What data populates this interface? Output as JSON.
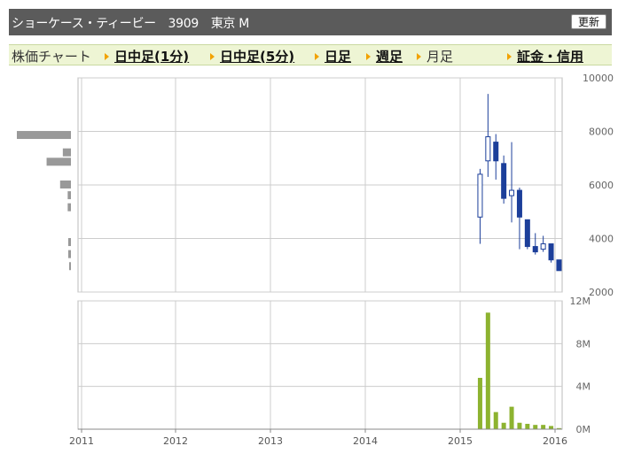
{
  "header": {
    "title": "ショーケース・ティービー　3909　東京 M",
    "refresh_label": "更新"
  },
  "tabs": [
    {
      "label": "株価チャート",
      "link": false,
      "arrow": false
    },
    {
      "label": "日中足(1分)",
      "link": true,
      "arrow": true
    },
    {
      "label": "日中足(5分)",
      "link": true,
      "arrow": true
    },
    {
      "label": "日足",
      "link": true,
      "arrow": true
    },
    {
      "label": "週足",
      "link": true,
      "arrow": true
    },
    {
      "label": "月足",
      "link": false,
      "arrow": true
    },
    {
      "label": "証金・信用",
      "link": true,
      "arrow": true
    }
  ],
  "colors": {
    "bar_up_fill": "#ffffff",
    "bar_down_fill": "#1c3f9a",
    "wick": "#1c3f9a",
    "volume": "#8db330",
    "price_volume_profile": "#999999",
    "grid": "#cccccc",
    "frame": "#bbbbbb"
  },
  "chart_data": [
    {
      "type": "candlestick",
      "x_ticks": [
        "2011",
        "2012",
        "2013",
        "2014",
        "2015",
        "2016"
      ],
      "ylim": [
        2000,
        10000
      ],
      "y_ticks": [
        "10000",
        "8000",
        "6000",
        "4000",
        "2000"
      ],
      "grid": true,
      "candles": [
        {
          "date": "2015-03",
          "open": 4800,
          "high": 6600,
          "low": 3800,
          "close": 6400
        },
        {
          "date": "2015-04",
          "open": 6900,
          "high": 9400,
          "low": 6300,
          "close": 7800
        },
        {
          "date": "2015-05",
          "open": 7600,
          "high": 7900,
          "low": 6200,
          "close": 6900
        },
        {
          "date": "2015-06",
          "open": 6800,
          "high": 7100,
          "low": 5300,
          "close": 5500
        },
        {
          "date": "2015-07",
          "open": 5600,
          "high": 7600,
          "low": 4600,
          "close": 5800
        },
        {
          "date": "2015-08",
          "open": 5800,
          "high": 5900,
          "low": 3600,
          "close": 4800
        },
        {
          "date": "2015-09",
          "open": 4700,
          "high": 4700,
          "low": 3600,
          "close": 3700
        },
        {
          "date": "2015-10",
          "open": 3700,
          "high": 4200,
          "low": 3400,
          "close": 3500
        },
        {
          "date": "2015-11",
          "open": 3600,
          "high": 4100,
          "low": 3500,
          "close": 3800
        },
        {
          "date": "2015-12",
          "open": 3800,
          "high": 3800,
          "low": 3100,
          "close": 3200
        },
        {
          "date": "2016-01",
          "open": 3200,
          "high": 3200,
          "low": 2800,
          "close": 2800
        }
      ],
      "price_volume_profile": [
        {
          "price": 7850,
          "volume": 1.0
        },
        {
          "price": 7200,
          "volume": 0.15
        },
        {
          "price": 6850,
          "volume": 0.45
        },
        {
          "price": 6000,
          "volume": 0.2
        },
        {
          "price": 5600,
          "volume": 0.06
        },
        {
          "price": 5150,
          "volume": 0.06
        },
        {
          "price": 3850,
          "volume": 0.05
        },
        {
          "price": 3400,
          "volume": 0.05
        },
        {
          "price": 2950,
          "volume": 0.03
        }
      ]
    },
    {
      "type": "bar",
      "ylim": [
        0,
        12000000
      ],
      "y_ticks": [
        "12M",
        "8M",
        "4M",
        "0M"
      ],
      "grid": true,
      "x": [
        "2015-03",
        "2015-04",
        "2015-05",
        "2015-06",
        "2015-07",
        "2015-08",
        "2015-09",
        "2015-10",
        "2015-11",
        "2015-12",
        "2016-01"
      ],
      "values": [
        4800000,
        10900000,
        1600000,
        600000,
        2100000,
        600000,
        500000,
        400000,
        400000,
        300000,
        100000
      ]
    }
  ]
}
